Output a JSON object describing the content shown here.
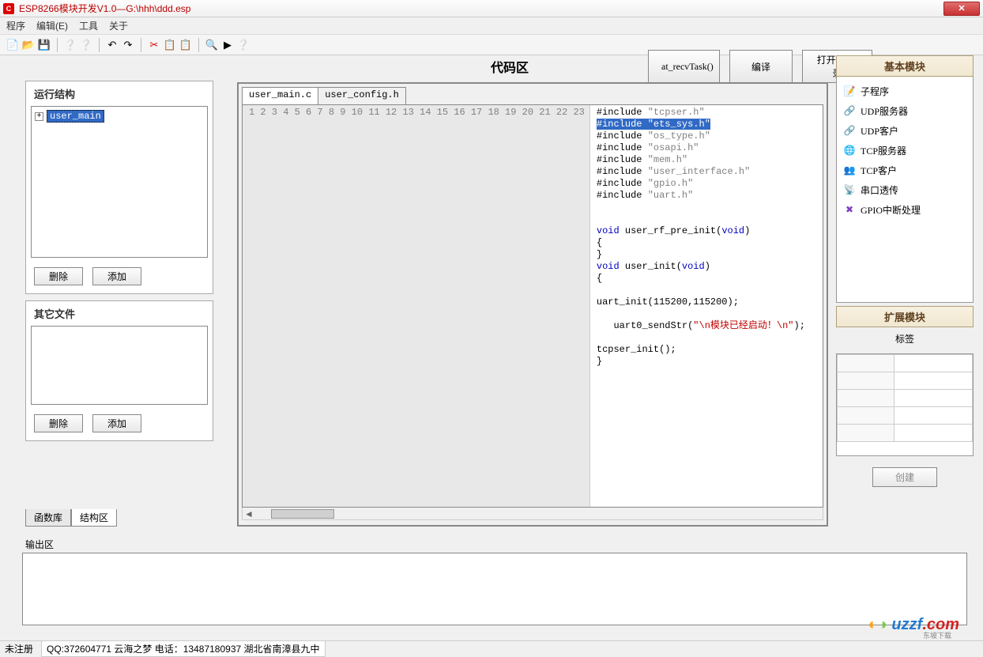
{
  "window": {
    "title": "ESP8266模块开发V1.0—G:\\hhh\\ddd.esp"
  },
  "menu": {
    "program": "程序",
    "edit": "编辑(E)",
    "tools": "工具",
    "about": "关于"
  },
  "left": {
    "run_struct_title": "运行结构",
    "tree_root": "user_main",
    "del": "删除",
    "add": "添加",
    "other_files_title": "其它文件",
    "tab_funclib": "函数库",
    "tab_struct": "结构区"
  },
  "center": {
    "title": "代码区",
    "btn_recv": "at_recvTask()",
    "btn_compile": "编译",
    "btn_openbin": "打开bin目录",
    "tab1": "user_main.c",
    "tab2": "user_config.h",
    "code": [
      {
        "n": 1,
        "kind": "inc",
        "val": "tcpser.h"
      },
      {
        "n": 2,
        "kind": "inc-hl",
        "val": "ets_sys.h"
      },
      {
        "n": 3,
        "kind": "inc",
        "val": "os_type.h"
      },
      {
        "n": 4,
        "kind": "inc",
        "val": "osapi.h"
      },
      {
        "n": 5,
        "kind": "inc",
        "val": "mem.h"
      },
      {
        "n": 6,
        "kind": "inc",
        "val": "user_interface.h"
      },
      {
        "n": 7,
        "kind": "inc",
        "val": "gpio.h"
      },
      {
        "n": 8,
        "kind": "inc",
        "val": "uart.h"
      },
      {
        "n": 9,
        "kind": "blank"
      },
      {
        "n": 10,
        "kind": "blank"
      },
      {
        "n": 11,
        "kind": "fn",
        "name": "user_rf_pre_init"
      },
      {
        "n": 12,
        "kind": "txt",
        "val": "{"
      },
      {
        "n": 13,
        "kind": "txt",
        "val": "}"
      },
      {
        "n": 14,
        "kind": "fn",
        "name": "user_init"
      },
      {
        "n": 15,
        "kind": "txt",
        "val": "{"
      },
      {
        "n": 16,
        "kind": "blank"
      },
      {
        "n": 17,
        "kind": "txt",
        "val": "uart_init(115200,115200);"
      },
      {
        "n": 18,
        "kind": "blank"
      },
      {
        "n": 19,
        "kind": "send",
        "prefix": "   uart0_sendStr(",
        "str": "\"\\n模块已经启动！\\n\"",
        "suffix": ");"
      },
      {
        "n": 20,
        "kind": "blank"
      },
      {
        "n": 21,
        "kind": "txt",
        "val": "tcpser_init();"
      },
      {
        "n": 22,
        "kind": "txt",
        "val": "}"
      },
      {
        "n": 23,
        "kind": "blank"
      }
    ]
  },
  "right": {
    "basic_title": "基本模块",
    "items": [
      {
        "icon": "📝",
        "label": "子程序",
        "color": "#c06000"
      },
      {
        "icon": "🔗",
        "label": "UDP服务器",
        "color": "#2060c0"
      },
      {
        "icon": "🔗",
        "label": "UDP客户",
        "color": "#2060c0"
      },
      {
        "icon": "🌐",
        "label": "TCP服务器",
        "color": "#208040"
      },
      {
        "icon": "👥",
        "label": "TCP客户",
        "color": "#c04000"
      },
      {
        "icon": "📡",
        "label": "串口透传",
        "color": "#604020"
      },
      {
        "icon": "✖",
        "label": "GPIO中断处理",
        "color": "#8040c0"
      }
    ],
    "ext_title": "扩展模块",
    "tag_label": "标签",
    "create": "创建"
  },
  "output": {
    "label": "输出区"
  },
  "status": {
    "unreg": "未注册",
    "info": "QQ:372604771 云海之梦 电话：13487180937 湖北省南漳县九中"
  },
  "watermark": {
    "brand": "uzzf",
    "suffix": ".com",
    "sub": "东坡下载"
  }
}
